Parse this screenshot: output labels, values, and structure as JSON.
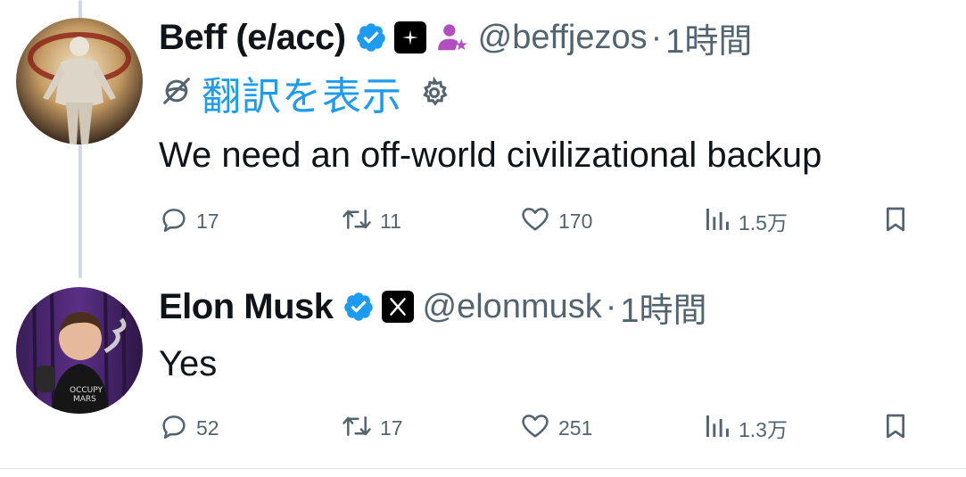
{
  "colors": {
    "accent": "#1d9bf0",
    "verified": "#1d9bf0",
    "secondary_text": "#536471",
    "affiliate_purple": "#b24ec0"
  },
  "tweets": [
    {
      "display_name": "Beff (e/acc)",
      "handle": "@beffjezos",
      "separator": "·",
      "time": "1時間",
      "translate_label": "翻訳を表示",
      "text": "We need an off-world civilizational backup",
      "icons": [
        "verified-badge-icon",
        "affiliate-x-icon",
        "subscriber-person-icon",
        "globe-slash-icon",
        "gear-icon"
      ],
      "stats": {
        "replies": "17",
        "retweets": "11",
        "likes": "170",
        "views": "1.5万"
      }
    },
    {
      "display_name": "Elon Musk",
      "handle": "@elonmusk",
      "separator": "·",
      "time": "1時間",
      "text": "Yes",
      "icons": [
        "verified-badge-icon",
        "affiliate-x-icon"
      ],
      "stats": {
        "replies": "52",
        "retweets": "17",
        "likes": "251",
        "views": "1.3万"
      }
    }
  ]
}
